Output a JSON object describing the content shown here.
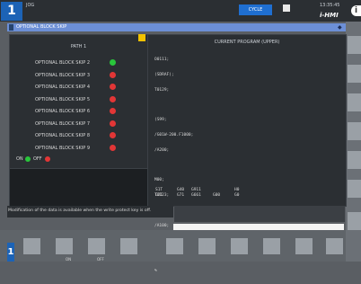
{
  "header": {
    "mode_number": "1",
    "mode_label": "JOG",
    "status_chip": "CYCLE",
    "clock": "13:35:45",
    "brand": "i-HMI",
    "info_icon": "info-icon"
  },
  "screen": {
    "title": "OPTIONAL BLOCK SKIP"
  },
  "left_panel": {
    "path_title": "PATH 1",
    "skips": [
      {
        "label": "OPTIONAL BLOCK SKIP 2",
        "state": "on"
      },
      {
        "label": "OPTIONAL BLOCK SKIP 3",
        "state": "off"
      },
      {
        "label": "OPTIONAL BLOCK SKIP 4",
        "state": "off"
      },
      {
        "label": "OPTIONAL BLOCK SKIP 5",
        "state": "off"
      },
      {
        "label": "OPTIONAL BLOCK SKIP 6",
        "state": "off"
      },
      {
        "label": "OPTIONAL BLOCK SKIP 7",
        "state": "off"
      },
      {
        "label": "OPTIONAL BLOCK SKIP 8",
        "state": "off"
      },
      {
        "label": "OPTIONAL BLOCK SKIP 9",
        "state": "off"
      }
    ],
    "legend_on": "ON",
    "legend_off": "OFF",
    "colors": {
      "on": "#29c63b",
      "off": "#e23636"
    }
  },
  "right_panel": {
    "title": "CURRENT PROGRAM (UPPER)",
    "lines": [
      "O0111;",
      "(SDRAF);",
      "T0129;",
      "",
      "(S99;",
      "/G01W-200.F1000;",
      "/A200;",
      "",
      "M00;",
      "T0123;",
      "/X-200.;",
      "/A100;",
      "/Z4XX;",
      "/X00;",
      "%"
    ],
    "footer": {
      "r1c1": "S1T",
      "r1c2": "G40",
      "r1c3": "G911",
      "r1c4": "H0",
      "r2c1": "G21",
      "r2c2": "G71",
      "r2c3": "G661",
      "r2c4": "G00",
      "r2c5": "G0"
    }
  },
  "message": {
    "text": "Modification of the data is available when the write protect key is off."
  },
  "bottom": {
    "mode_number": "1",
    "key_labels": [
      "ON",
      "OFF"
    ]
  }
}
